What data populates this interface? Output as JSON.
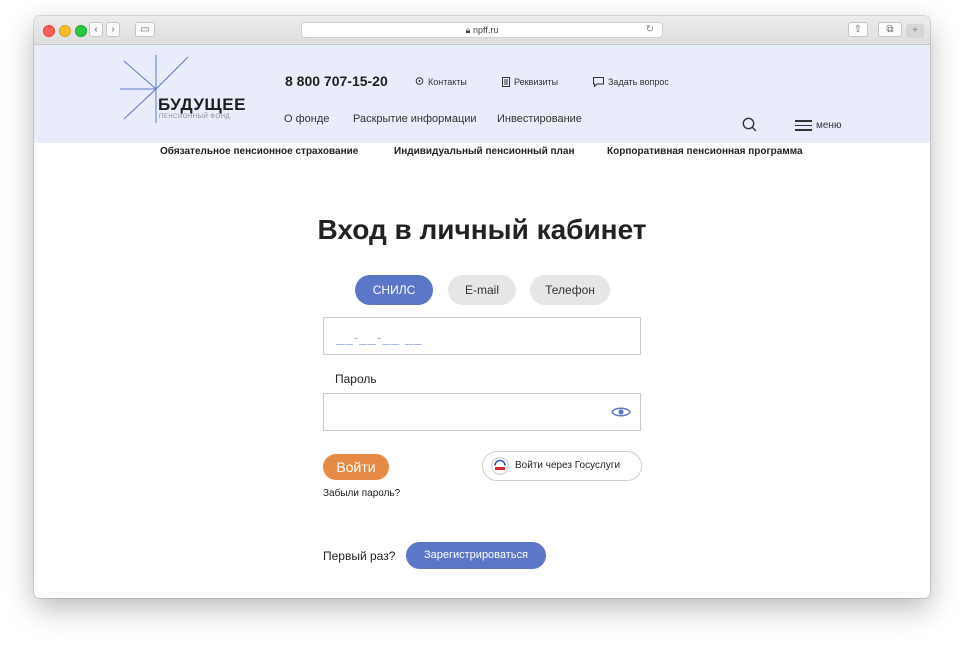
{
  "browser": {
    "url": "npff.ru"
  },
  "brand": {
    "name": "БУДУЩЕЕ",
    "subtitle": "ПЕНСИОННЫЙ ФОНД"
  },
  "header": {
    "phone": "8 800 707-15-20",
    "top_links": [
      "Контакты",
      "Реквизиты",
      "Задать вопрос"
    ],
    "nav": [
      "О фонде",
      "Раскрытие информации",
      "Инвестирование"
    ],
    "menu_label": "меню"
  },
  "subnav": [
    "Обязательное пенсионное страхование",
    "Индивидуальный пенсионный план",
    "Корпоративная пенсионная программа"
  ],
  "login": {
    "title": "Вход в личный кабинет",
    "tabs": [
      "СНИЛС",
      "E-mail",
      "Телефон"
    ],
    "active_tab": "СНИЛС",
    "snils_placeholder": "__-__-__ __",
    "password_label": "Пароль",
    "login_button": "Войти",
    "gosuslugi_button": "Войти через Госуслуги",
    "forgot_link": "Забыли пароль?",
    "first_time": "Первый раз?",
    "register_button": "Зарегистрироваться"
  },
  "colors": {
    "header_bg": "#e9edfb",
    "primary": "#5b76c7",
    "accent": "#e48a45"
  }
}
